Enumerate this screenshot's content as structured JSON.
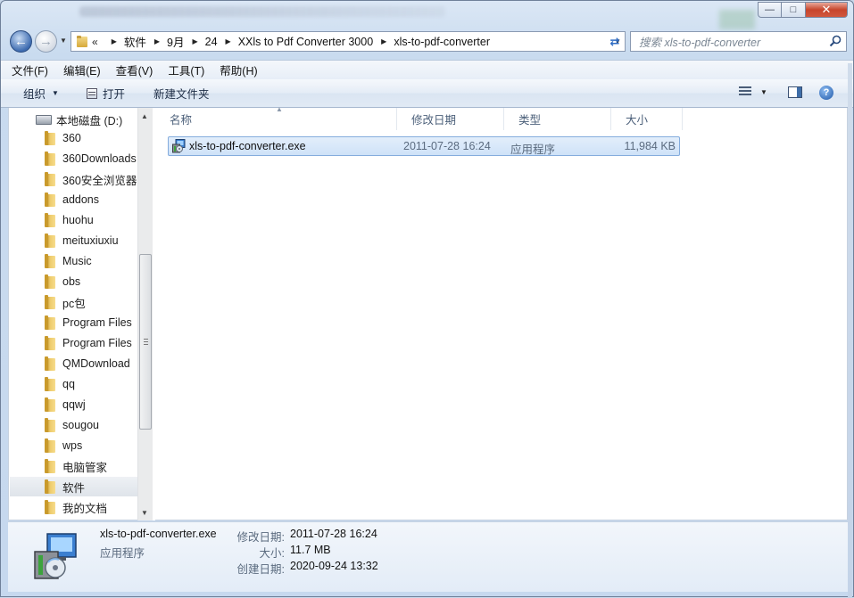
{
  "window": {
    "controls": {
      "minimize": "—",
      "maximize": "□",
      "close": "✕"
    }
  },
  "nav": {
    "breadcrumb_overflow": "«",
    "breadcrumbs": [
      "软件",
      "9月",
      "24",
      "XXls to Pdf Converter 3000",
      "xls-to-pdf-converter"
    ],
    "search_placeholder": "搜索 xls-to-pdf-converter"
  },
  "menubar": [
    "文件(F)",
    "编辑(E)",
    "查看(V)",
    "工具(T)",
    "帮助(H)"
  ],
  "toolbar": {
    "organize": "组织",
    "open": "打开",
    "new_folder": "新建文件夹"
  },
  "navpane": {
    "drive": "本地磁盘 (D:)",
    "folders": [
      "360",
      "360Downloads",
      "360安全浏览器",
      "addons",
      "huohu",
      "meituxiuxiu",
      "Music",
      "obs",
      "pc包",
      "Program Files",
      "Program Files",
      "QMDownload",
      "qq",
      "qqwj",
      "sougou",
      "wps",
      "电脑管家",
      "软件",
      "我的文档"
    ],
    "selected_folder": "软件"
  },
  "filelist": {
    "columns": [
      "名称",
      "修改日期",
      "类型",
      "大小"
    ],
    "files": [
      {
        "name": "xls-to-pdf-converter.exe",
        "modified": "2011-07-28 16:24",
        "type": "应用程序",
        "size": "11,984 KB"
      }
    ]
  },
  "details": {
    "name": "xls-to-pdf-converter.exe",
    "type": "应用程序",
    "modified_label": "修改日期:",
    "modified": "2011-07-28 16:24",
    "size_label": "大小:",
    "size": "11.7 MB",
    "created_label": "创建日期:",
    "created": "2020-09-24 13:32"
  },
  "colors": {
    "selection": "#cfe2f8",
    "selection_border": "#84acdd",
    "chrome": "#c9dbef",
    "close_button": "#c7452c"
  }
}
